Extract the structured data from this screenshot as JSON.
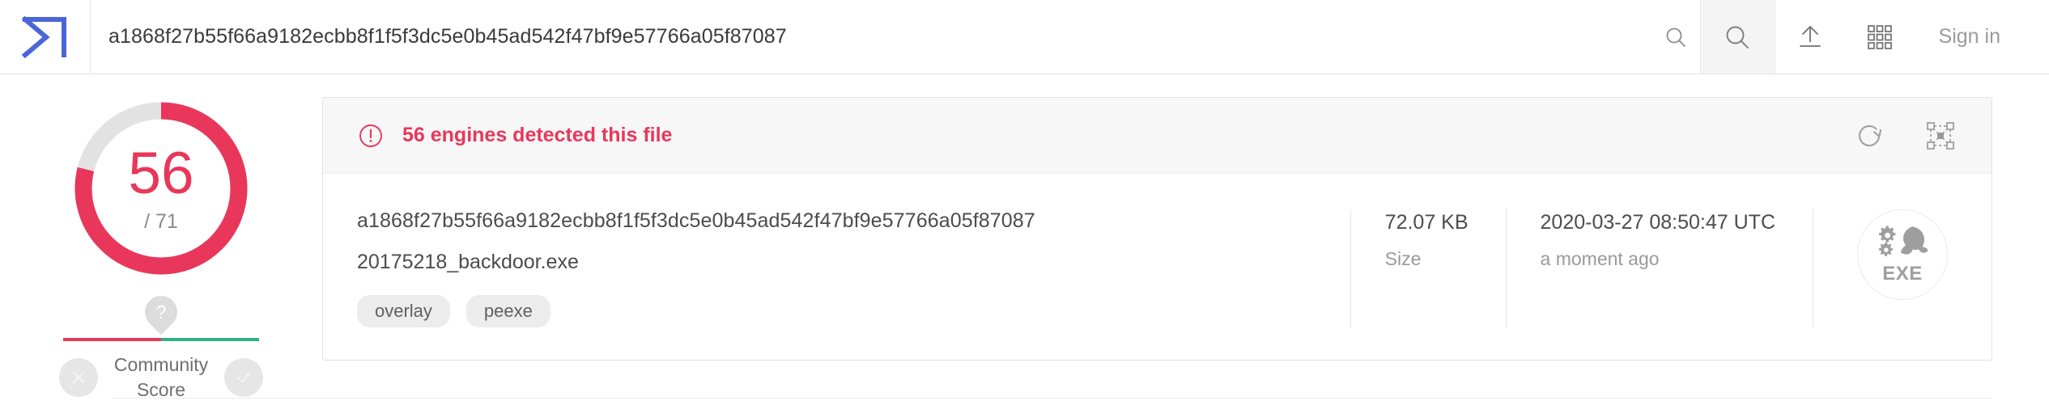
{
  "header": {
    "logo_name": "virustotal-logo",
    "search": {
      "value": "a1868f27b55f66a9182ecbb8f1f5f3dc5e0b45ad542f47bf9e57766a05f87087",
      "placeholder": "URL, IP address, domain, or file hash"
    },
    "inline_search_icon": "search-icon",
    "search_button_icon": "search-icon",
    "upload_icon": "upload-icon",
    "apps_icon": "grid-apps-icon",
    "sign_in_label": "Sign in"
  },
  "detection": {
    "score": "56",
    "total": "/ 71",
    "ring_value": 56,
    "ring_total": 71,
    "ring_color": "#e8375a",
    "ring_track_color": "#e2e2e2"
  },
  "community": {
    "pin_icon": "question-mark-pin-icon",
    "label": "Community\nScore",
    "label_line1": "Community",
    "label_line2": "Score",
    "negative_icon": "x-icon",
    "positive_icon": "check-icon",
    "negative_color": "#e8375a",
    "positive_color": "#2fb281"
  },
  "card": {
    "alert": {
      "icon": "exclamation-circle-icon",
      "text": "56 engines detected this file",
      "color": "#e8375a"
    },
    "actions": {
      "reanalyze_icon": "reanalyze-refresh-icon",
      "similar_icon": "relations-graph-icon"
    },
    "file": {
      "hash": "a1868f27b55f66a9182ecbb8f1f5f3dc5e0b45ad542f47bf9e57766a05f87087",
      "name": "20175218_backdoor.exe",
      "tags": [
        "overlay",
        "peexe"
      ]
    },
    "size": {
      "value": "72.07 KB",
      "label": "Size"
    },
    "date": {
      "value": "2020-03-27 08:50:47 UTC",
      "label": "a moment ago"
    },
    "filetype": {
      "icon": "exe-gears-icon",
      "label": "EXE"
    }
  }
}
